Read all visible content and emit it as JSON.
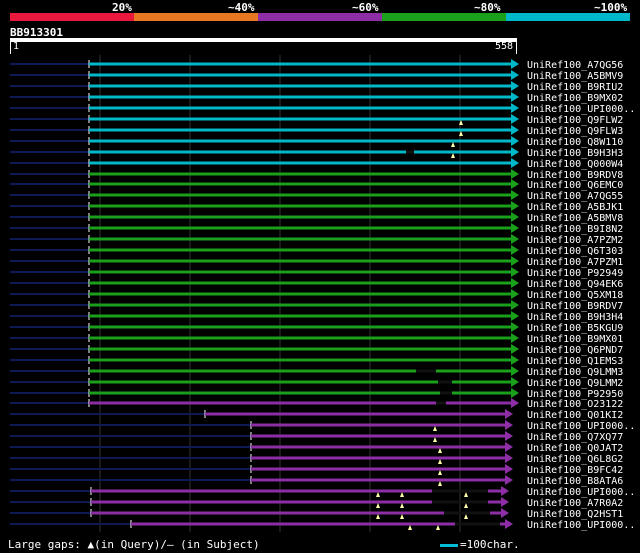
{
  "legend": {
    "segments": [
      {
        "color": "#e8193c"
      },
      {
        "color": "#e87722"
      },
      {
        "color": "#8e2ea6"
      },
      {
        "color": "#1aa01a"
      },
      {
        "color": "#00b8c8"
      }
    ],
    "labels": [
      "20%",
      "~40%",
      "~60%",
      "~80%",
      "~100%"
    ]
  },
  "query": {
    "id": "BB913301",
    "start": "1",
    "end": "558"
  },
  "hits": [
    {
      "name": "UniRef100_A7QG56",
      "color": "#00b8c8"
    },
    {
      "name": "UniRef100_A5BMV9",
      "color": "#00b8c8"
    },
    {
      "name": "UniRef100_B9RIU2",
      "color": "#00b8c8"
    },
    {
      "name": "UniRef100_B9MX02",
      "color": "#00b8c8"
    },
    {
      "name": "UniRef100_UPI000..",
      "color": "#00b8c8"
    },
    {
      "name": "UniRef100_Q9FLW2",
      "color": "#00b8c8"
    },
    {
      "name": "UniRef100_Q9FLW3",
      "color": "#00b8c8"
    },
    {
      "name": "UniRef100_Q8W110",
      "color": "#00b8c8"
    },
    {
      "name": "UniRef100_B9H3H3",
      "color": "#00b8c8"
    },
    {
      "name": "UniRef100_Q000W4",
      "color": "#00b8c8"
    },
    {
      "name": "UniRef100_B9RDV8",
      "color": "#1aa01a"
    },
    {
      "name": "UniRef100_Q6EMC0",
      "color": "#1aa01a"
    },
    {
      "name": "UniRef100_A7QG55",
      "color": "#1aa01a"
    },
    {
      "name": "UniRef100_A5BJK1",
      "color": "#1aa01a"
    },
    {
      "name": "UniRef100_A5BMV8",
      "color": "#1aa01a"
    },
    {
      "name": "UniRef100_B9I8N2",
      "color": "#1aa01a"
    },
    {
      "name": "UniRef100_A7PZM2",
      "color": "#1aa01a"
    },
    {
      "name": "UniRef100_Q6T303",
      "color": "#1aa01a"
    },
    {
      "name": "UniRef100_A7PZM1",
      "color": "#1aa01a"
    },
    {
      "name": "UniRef100_P92949",
      "color": "#1aa01a"
    },
    {
      "name": "UniRef100_Q94EK6",
      "color": "#1aa01a"
    },
    {
      "name": "UniRef100_Q5XM18",
      "color": "#1aa01a"
    },
    {
      "name": "UniRef100_B9RDV7",
      "color": "#1aa01a"
    },
    {
      "name": "UniRef100_B9H3H4",
      "color": "#1aa01a"
    },
    {
      "name": "UniRef100_B5KGU9",
      "color": "#1aa01a"
    },
    {
      "name": "UniRef100_B9MX01",
      "color": "#1aa01a"
    },
    {
      "name": "UniRef100_Q6PND7",
      "color": "#1aa01a"
    },
    {
      "name": "UniRef100_Q1EMS3",
      "color": "#1aa01a"
    },
    {
      "name": "UniRef100_Q9LMM3",
      "color": "#1aa01a"
    },
    {
      "name": "UniRef100_Q9LMM2",
      "color": "#1aa01a"
    },
    {
      "name": "UniRef100_P92950",
      "color": "#1aa01a"
    },
    {
      "name": "UniRef100_O23122",
      "color": "#8e2ea6"
    },
    {
      "name": "UniRef100_Q01KI2",
      "color": "#8e2ea6"
    },
    {
      "name": "UniRef100_UPI000..",
      "color": "#8e2ea6"
    },
    {
      "name": "UniRef100_Q7XQ77",
      "color": "#8e2ea6"
    },
    {
      "name": "UniRef100_Q0JAT2",
      "color": "#8e2ea6"
    },
    {
      "name": "UniRef100_Q6L8G2",
      "color": "#8e2ea6"
    },
    {
      "name": "UniRef100_B9FC42",
      "color": "#8e2ea6"
    },
    {
      "name": "UniRef100_B8ATA6",
      "color": "#8e2ea6"
    },
    {
      "name": "UniRef100_UPI000..",
      "color": "#8e2ea6"
    },
    {
      "name": "UniRef100_A7R0A2",
      "color": "#8e2ea6"
    },
    {
      "name": "UniRef100_Q2HST1",
      "color": "#8e2ea6"
    },
    {
      "name": "UniRef100_UPI000..",
      "color": "#8e2ea6"
    }
  ],
  "footer": {
    "gaps_text": "Large gaps: ▲(in Query)/– (in Subject)",
    "scale_text": "=100char."
  }
}
